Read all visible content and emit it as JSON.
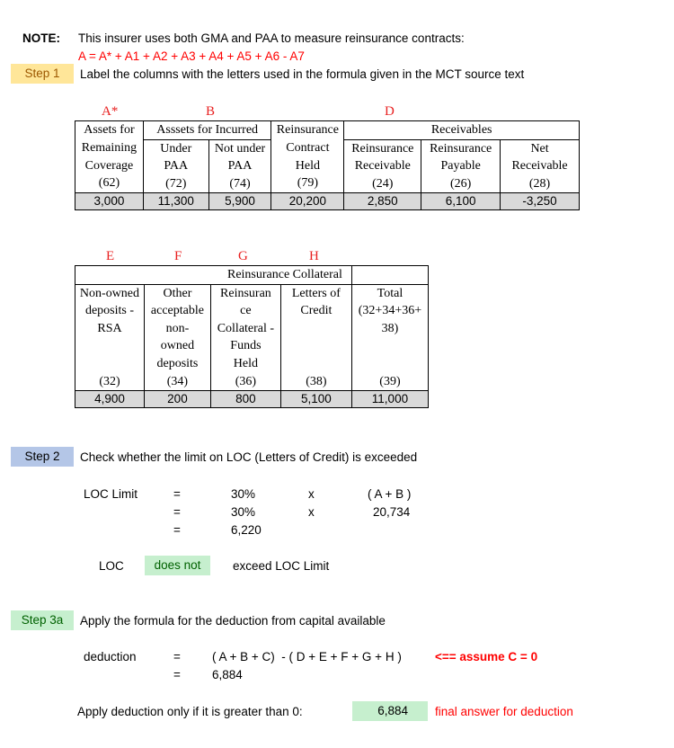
{
  "note": {
    "label": "NOTE:",
    "text": "This insurer uses both GMA and PAA to measure reinsurance contracts:",
    "formula": "A = A* + A1 + A2 + A3 + A4 + A5 + A6 - A7"
  },
  "step1": {
    "badge": "Step 1",
    "badge_color": "#ffe699",
    "text": "Label the columns with the letters used in the formula given in the MCT source text"
  },
  "table1": {
    "letters": {
      "a_star": "A*",
      "b": "B",
      "d": "D"
    },
    "group_headers": {
      "assets_for_incurred": "Asssets for Incurred",
      "receivables": "Receivables"
    },
    "columns": [
      {
        "line1": "Assets for",
        "line2": "Remaining",
        "line3": "Coverage",
        "code": "(62)",
        "value": "3,000"
      },
      {
        "line1": "Under",
        "line2": "PAA",
        "code": "(72)",
        "value": "11,300"
      },
      {
        "line1": "Not under",
        "line2": "PAA",
        "code": "(74)",
        "value": "5,900"
      },
      {
        "line1": "Reinsurance",
        "line2": "Contract",
        "line3": "Held",
        "code": "(79)",
        "value": "20,200"
      },
      {
        "line1": "Reinsurance",
        "line2": "Receivable",
        "code": "(24)",
        "value": "2,850"
      },
      {
        "line1": "Reinsurance",
        "line2": "Payable",
        "code": "(26)",
        "value": "6,100"
      },
      {
        "line1": "Net",
        "line2": "Receivable",
        "code": "(28)",
        "value": "-3,250"
      }
    ]
  },
  "table2": {
    "letters": {
      "e": "E",
      "f": "F",
      "g": "G",
      "h": "H"
    },
    "group_header": "Reinsurance Collateral",
    "columns": [
      {
        "lines": [
          "Non-owned",
          "deposits -",
          "RSA"
        ],
        "code": "(32)",
        "value": "4,900"
      },
      {
        "lines": [
          "Other",
          "acceptable",
          "non-",
          "owned",
          "deposits"
        ],
        "code": "(34)",
        "value": "200"
      },
      {
        "lines": [
          "Reinsuran",
          "ce",
          "Collateral -",
          "Funds",
          "Held"
        ],
        "code": "(36)",
        "value": "800"
      },
      {
        "lines": [
          "Letters of",
          "Credit"
        ],
        "code": "(38)",
        "value": "5,100"
      },
      {
        "lines": [
          "Total",
          "(32+34+36+",
          "38)"
        ],
        "code": "(39)",
        "value": "11,000"
      }
    ]
  },
  "step2": {
    "badge": "Step 2",
    "badge_color": "#b4c6e7",
    "text": "Check whether the limit on LOC (Letters of Credit) is exceeded",
    "loc_limit_label": "LOC Limit",
    "eq": "=",
    "times": "x",
    "pct": "30%",
    "expr": "( A + B )",
    "ab_value": "20,734",
    "limit_value": "6,220",
    "loc_label": "LOC",
    "result_badge": "does not",
    "result_badge_color": "#c6efce",
    "result_text": "exceed LOC Limit"
  },
  "step3a": {
    "badge": "Step 3a",
    "badge_color": "#c6efce",
    "text": "Apply the formula for the deduction from capital available",
    "deduction_label": "deduction",
    "eq": "=",
    "formula": "( A + B + C)  - ( D + E + F + G + H )",
    "assumption": "<== assume C = 0",
    "deduction_value": "6,884",
    "apply_text": "Apply deduction only if it is greater than 0:",
    "final_value": "6,884",
    "final_label": "final answer for deduction"
  }
}
